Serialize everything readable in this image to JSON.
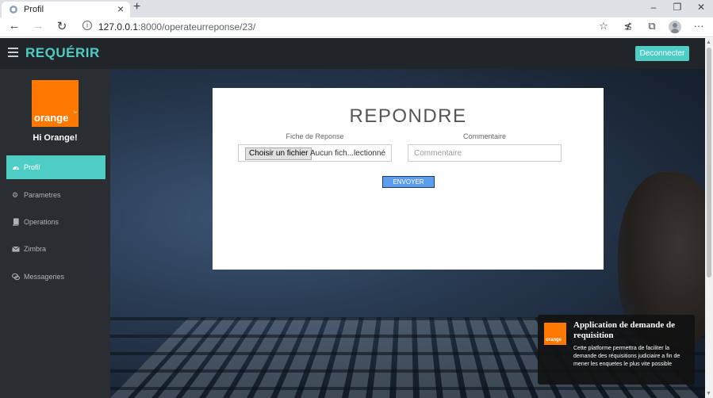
{
  "browser": {
    "tab_title": "Profil",
    "url_host": "127.0.0.1",
    "url_path": ":8000/operateurreponse/23/"
  },
  "header": {
    "brand": "REQUÉRIR",
    "logout_label": "Deconnecter"
  },
  "sidebar": {
    "logo_text": "orange",
    "logo_tm": "™",
    "greeting": "Hi Orange!",
    "items": [
      {
        "label": "Profil",
        "icon": "dashboard-icon",
        "active": true
      },
      {
        "label": "Parametres",
        "icon": "cogs-icon",
        "active": false
      },
      {
        "label": "Operations",
        "icon": "book-icon",
        "active": false
      },
      {
        "label": "Zimbra",
        "icon": "envelope-icon",
        "active": false
      },
      {
        "label": "Messageries",
        "icon": "comments-icon",
        "active": false
      }
    ]
  },
  "form": {
    "title": "REPONDRE",
    "file_label": "Fiche de Reponse",
    "file_button": "Choisir un fichier",
    "file_status": "Aucun fich...lectionné",
    "comment_label": "Commentaire",
    "comment_placeholder": "Commentaire",
    "submit_label": "ENVOYER"
  },
  "toast": {
    "logo_text": "orange",
    "title": "Application de demande de requisition",
    "body": "Cette platforme permettra de faciliter la demande des réquisitions judiciaire a fin de mener les enquetes le plus vite possible"
  },
  "colors": {
    "accent": "#4ecdc4",
    "orange": "#ff7900",
    "header_bg": "#212529",
    "sidebar_bg": "#2a2d31",
    "submit_btn": "#5c9ded"
  }
}
